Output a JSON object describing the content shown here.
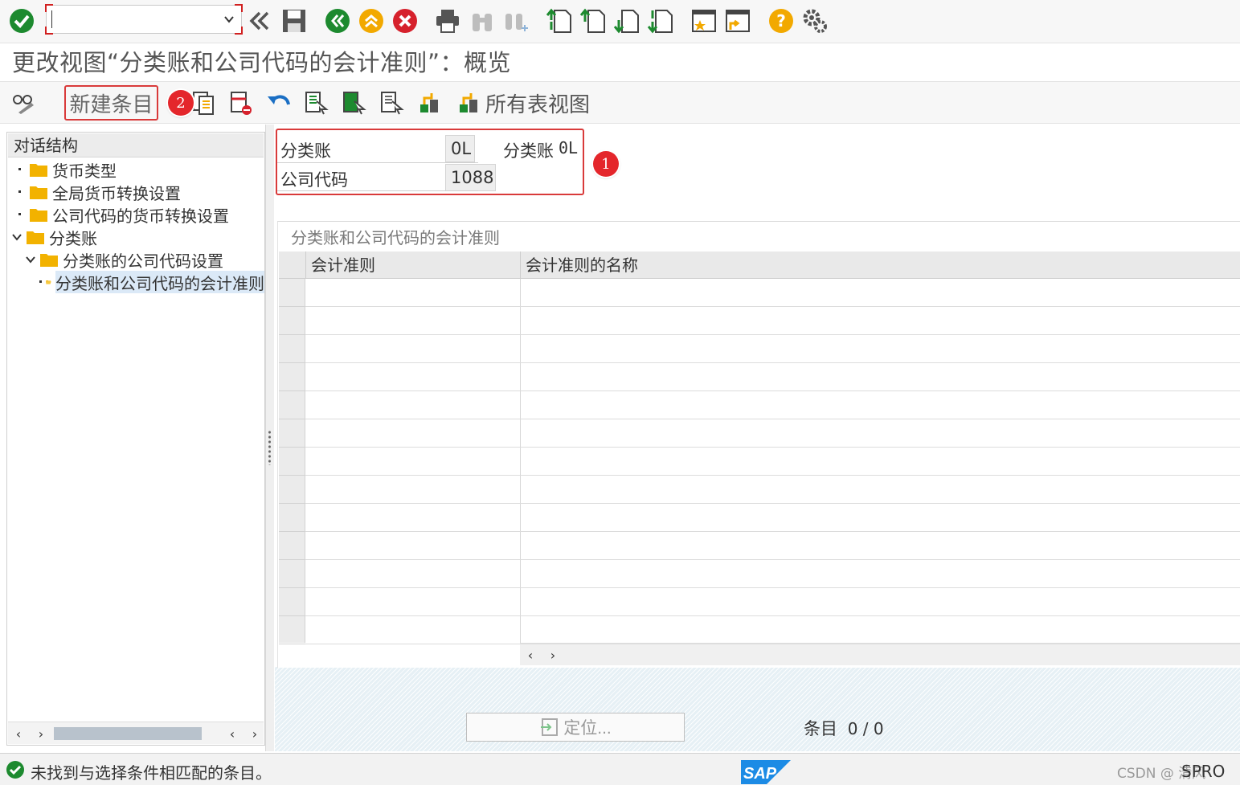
{
  "system_toolbar": {
    "command_field_value": "",
    "icons": [
      "enter-icon",
      "back-double-icon",
      "save-icon",
      "back-icon",
      "exit-icon",
      "cancel-icon",
      "print-icon",
      "find-icon",
      "find-next-icon",
      "first-page-icon",
      "prev-page-icon",
      "next-page-icon",
      "last-page-icon",
      "new-session-icon",
      "shortcut-icon",
      "help-icon",
      "settings-icon"
    ]
  },
  "title": "更改视图“分类账和公司代码的会计准则”：概览",
  "app_toolbar": {
    "new_entries_label": "新建条目",
    "all_views_label": "所有表视图",
    "badge_1": "1",
    "badge_2": "2"
  },
  "tree": {
    "header": "对话结构",
    "nodes": [
      {
        "label": "货币类型"
      },
      {
        "label": "全局货币转换设置"
      },
      {
        "label": "公司代码的货币转换设置"
      },
      {
        "label": "分类账"
      },
      {
        "label": "分类账的公司代码设置"
      },
      {
        "label": "分类账和公司代码的会计准则"
      }
    ]
  },
  "key_fields": {
    "ledger_label": "分类账",
    "ledger_value": "0L",
    "ledger_desc_label": "分类账",
    "ledger_desc_value": "0L",
    "company_label": "公司代码",
    "company_value": "1088"
  },
  "table": {
    "caption": "分类账和公司代码的会计准则",
    "columns": [
      "会计准则",
      "会计准则的名称"
    ],
    "rows": []
  },
  "locate_button": "定位...",
  "entries": {
    "label": "条目",
    "value": "0 / 0"
  },
  "status": {
    "message": "未找到与选择条件相匹配的条目。",
    "tcode": "SPRO",
    "watermark": "CSDN @ 清风"
  },
  "colors": {
    "accent_red": "#d93a3a",
    "green_ok": "#1d8a2f",
    "folder_yellow": "#f2b200",
    "selection_blue": "#dbe9f7"
  }
}
